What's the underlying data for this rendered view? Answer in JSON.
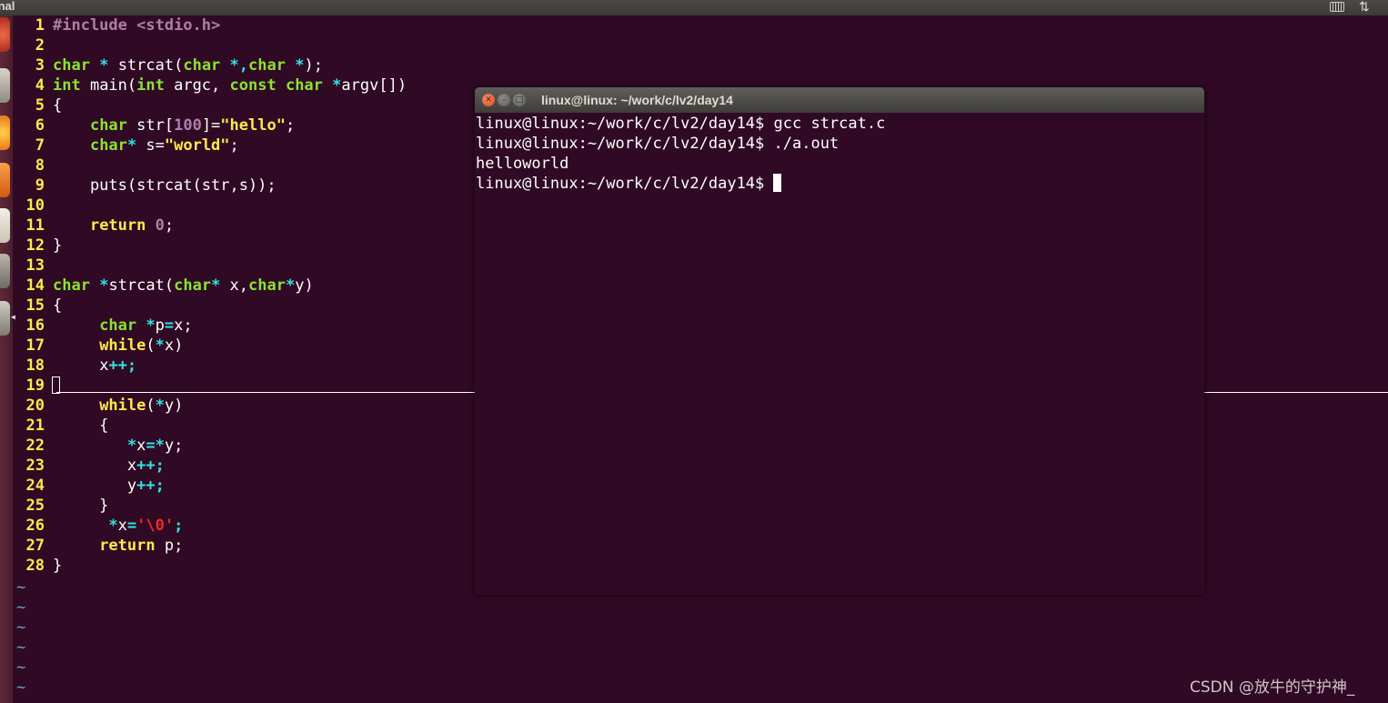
{
  "panel": {
    "title": "inal"
  },
  "terminal": {
    "title": "linux@linux: ~/work/c/lv2/day14",
    "lines": [
      "linux@linux:~/work/c/lv2/day14$ gcc strcat.c",
      "linux@linux:~/work/c/lv2/day14$ ./a.out",
      "helloworld",
      "linux@linux:~/work/c/lv2/day14$"
    ]
  },
  "editor": {
    "line_numbers": [
      "1",
      "2",
      "3",
      "4",
      "5",
      "6",
      "7",
      "8",
      "9",
      "10",
      "11",
      "12",
      "13",
      "14",
      "15",
      "16",
      "17",
      "18",
      "19",
      "20",
      "21",
      "22",
      "23",
      "24",
      "25",
      "26",
      "27",
      "28"
    ],
    "code": {
      "l1_pp": "#include",
      "l1_inc": " <stdio.h>",
      "l3_ty1": "char",
      "l3_a": " ",
      "l3_op1": "*",
      "l3_b": " strcat(",
      "l3_ty2": "char",
      "l3_c": " ",
      "l3_op2": "*,",
      "l3_ty3": "char",
      "l3_d": " ",
      "l3_op3": "*",
      "l3_e": ");",
      "l4_ty1": "int",
      "l4_a": " main(",
      "l4_ty2": "int",
      "l4_b": " argc, ",
      "l4_ty3": "const",
      "l4_c": " ",
      "l4_ty4": "char",
      "l4_d": " ",
      "l4_op1": "*",
      "l4_e": "argv[])",
      "l5": "{",
      "l6_ind": "    ",
      "l6_ty": "char",
      "l6_a": " str[",
      "l6_num": "100",
      "l6_b": "]=",
      "l6_st": "\"hello\"",
      "l6_c": ";",
      "l7_ind": "    ",
      "l7_ty": "char",
      "l7_op": "*",
      "l7_a": " s=",
      "l7_st": "\"world\"",
      "l7_b": ";",
      "l9": "    puts(strcat(str,s));",
      "l11_ind": "    ",
      "l11_kw": "return",
      "l11_a": " ",
      "l11_num": "0",
      "l11_b": ";",
      "l12": "}",
      "l14_ty1": "char",
      "l14_a": " ",
      "l14_op1": "*",
      "l14_b": "strcat(",
      "l14_ty2": "char",
      "l14_op2": "*",
      "l14_c": " x,",
      "l14_ty3": "char",
      "l14_op3": "*",
      "l14_d": "y)",
      "l15": "{",
      "l16_ind": "     ",
      "l16_ty": "char",
      "l16_a": " ",
      "l16_op1": "*",
      "l16_b": "p",
      "l16_op2": "=",
      "l16_c": "x;",
      "l17_ind": "     ",
      "l17_kw": "while",
      "l17_a": "(",
      "l17_op": "*",
      "l17_b": "x)",
      "l18_ind": "     ",
      "l18_a": "x",
      "l18_op": "++",
      "l18_b": ";",
      "l20_ind": "     ",
      "l20_kw": "while",
      "l20_a": "(",
      "l20_op": "*",
      "l20_b": "y)",
      "l21": "     {",
      "l22_ind": "        ",
      "l22_op1": "*",
      "l22_a": "x",
      "l22_op2": "=*",
      "l22_b": "y;",
      "l23_ind": "        ",
      "l23_a": "x",
      "l23_op": "++",
      "l23_b": ";",
      "l24_ind": "        ",
      "l24_a": "y",
      "l24_op": "++",
      "l24_b": ";",
      "l25": "     }",
      "l26_ind": "      ",
      "l26_op1": "*",
      "l26_a": "x",
      "l26_op2": "=",
      "l26_esc": "'\\0'",
      "l26_b": ";",
      "l27_ind": "     ",
      "l27_kw": "return",
      "l27_a": " p;",
      "l28": "}"
    },
    "tilde": "~"
  },
  "watermark": "CSDN @放牛的守护神_",
  "colors": {
    "background": "#300a24",
    "line_number": "#fce94f",
    "type_keyword": "#8ae234",
    "string": "#fce94f",
    "operator": "#34e2e2",
    "preproc": "#ad7fa8",
    "escape": "#ef2929",
    "tilde": "#729fcf"
  }
}
